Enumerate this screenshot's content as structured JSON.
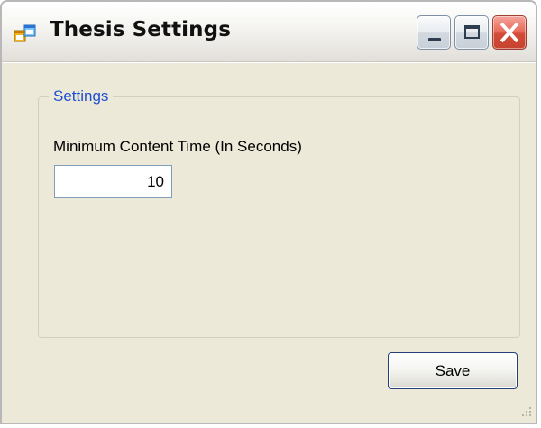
{
  "window": {
    "title": "Thesis Settings",
    "icon": "application-window-icon"
  },
  "caption_buttons": {
    "minimize": "minimize-icon",
    "maximize": "maximize-icon",
    "close": "close-icon",
    "close_color": "#d24b38"
  },
  "settings_group": {
    "title": "Settings",
    "title_color": "#1f4fd1",
    "minimum_content_time_label": "Minimum Content Time (In Seconds)",
    "minimum_content_time_value": "10"
  },
  "actions": {
    "save_label": "Save"
  }
}
